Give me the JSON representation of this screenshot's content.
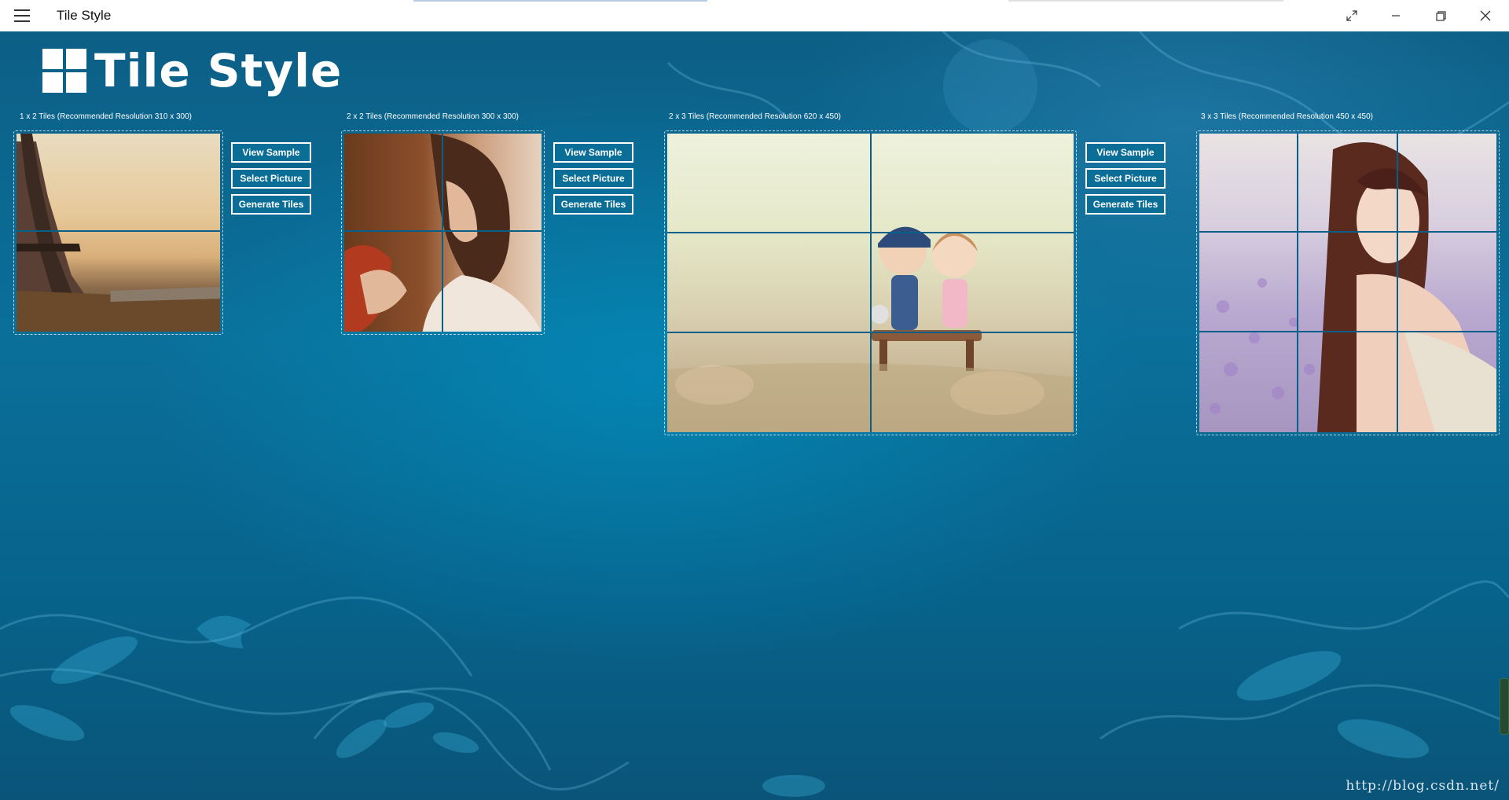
{
  "app": {
    "title": "Tile Style"
  },
  "window": {
    "buttons": [
      "menu-icon",
      "expand-icon",
      "minimize-icon",
      "restore-icon",
      "close-icon"
    ]
  },
  "logo": {
    "text": "Tile Style"
  },
  "colors": {
    "accent": "#0b6e97",
    "button_border": "#ffffff",
    "grid_line": "#0a5f88",
    "background": "#0a6f9a"
  },
  "sections": [
    {
      "caption": "1 x 2 Tiles (Recommended Resolution 310 x 300)",
      "picture": "eiffel-tower-photo"
    },
    {
      "caption": "2 x 2 Tiles (Recommended Resolution 300 x 300)",
      "picture": "girl-portrait-photo"
    },
    {
      "caption": "2 x 3 Tiles (Recommended Resolution 620 x 450)",
      "picture": "cartoon-couple-bench-photo"
    },
    {
      "caption": "3 x 3 Tiles (Recommended Resolution 450 x 450)",
      "picture": "woman-flower-field-photo"
    }
  ],
  "buttons": {
    "view_sample": "View Sample",
    "select_picture": "Select Picture",
    "generate_tiles": "Generate Tiles"
  },
  "watermark": "http://blog.csdn.net/"
}
